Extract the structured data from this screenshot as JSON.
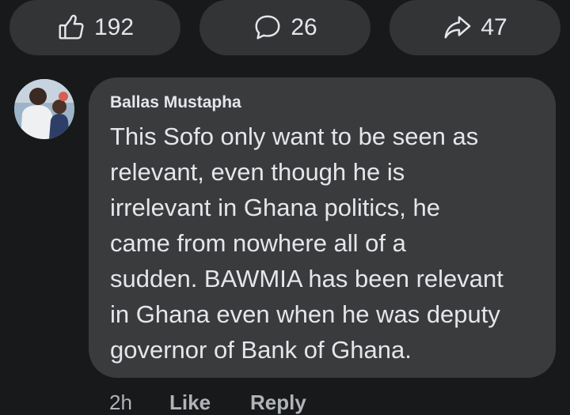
{
  "reactions": {
    "like": {
      "count": "192",
      "icon": "thumbs-up-icon"
    },
    "comment": {
      "count": "26",
      "icon": "comment-bubble-icon"
    },
    "share": {
      "count": "47",
      "icon": "share-arrow-icon"
    }
  },
  "comment": {
    "author": "Ballas Mustapha",
    "lines": [
      "This Sofo only want to be seen as",
      "relevant, even though he is",
      "irrelevant in Ghana politics, he",
      "came from nowhere all of a",
      "sudden. BAWMIA has been relevant",
      "in Ghana even when he was deputy",
      "governor of Bank of Ghana."
    ],
    "actions": {
      "time": "2h",
      "like": "Like",
      "reply": "Reply"
    }
  },
  "colors": {
    "background": "#18191a",
    "pill": "#323436",
    "bubble": "#3a3b3c",
    "text": "#e4e6eb",
    "muted": "#b0b3b8"
  }
}
